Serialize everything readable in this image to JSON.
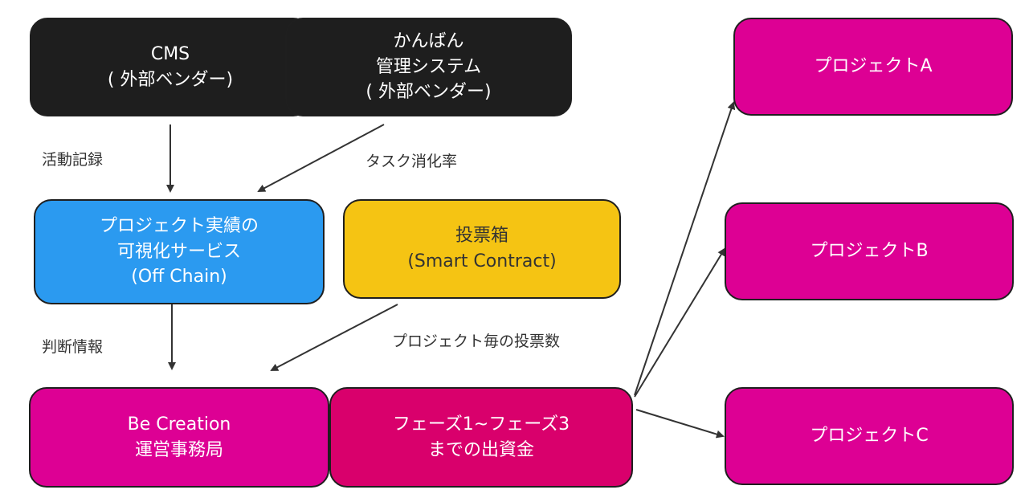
{
  "nodes": {
    "cms": {
      "line1": "CMS",
      "line2": "( 外部ベンダー)"
    },
    "kanban": {
      "line1": "かんばん",
      "line2": "管理システム",
      "line3": "( 外部ベンダー)"
    },
    "visualization": {
      "line1": "プロジェクト実績の",
      "line2": "可視化サービス",
      "line3": "(Off Chain)"
    },
    "ballot_box": {
      "line1": "投票箱",
      "line2": "(Smart Contract)"
    },
    "be_creation": {
      "line1": "Be Creation",
      "line2": "運営事務局"
    },
    "funding": {
      "line1": "フェーズ1~フェーズ3",
      "line2": "までの出資金"
    },
    "project_a": {
      "label": "プロジェクトA"
    },
    "project_b": {
      "label": "プロジェクトB"
    },
    "project_c": {
      "label": "プロジェクトC"
    }
  },
  "edge_labels": {
    "activity_log": "活動記録",
    "task_rate": "タスク消化率",
    "decision_info": "判断情報",
    "votes_per_project": "プロジェクト毎の投票数"
  },
  "colors": {
    "dark": "#1e1e1e",
    "blue": "#2b9af0",
    "yellow": "#f5c413",
    "magenta": "#dd0094",
    "crimson": "#d9006c",
    "edge": "#333333"
  }
}
